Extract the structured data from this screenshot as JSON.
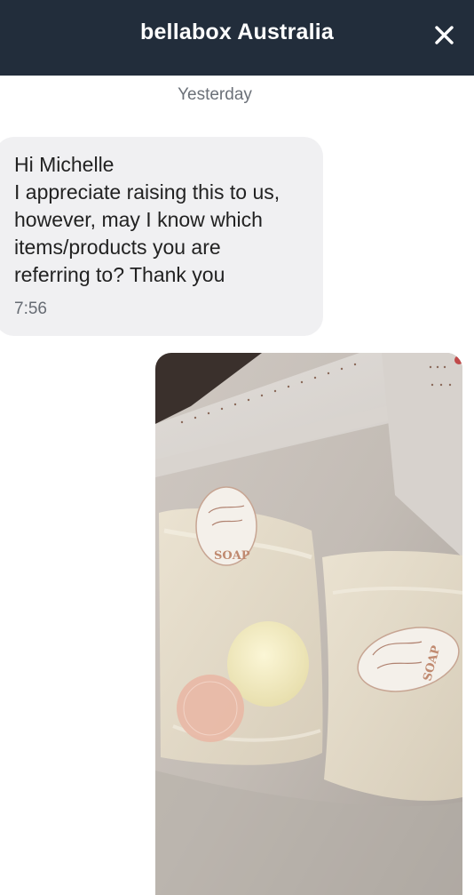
{
  "header": {
    "title": "bellabox Australia",
    "close_icon": "close-icon"
  },
  "conversation": {
    "date_separator": "Yesterday",
    "messages": [
      {
        "direction": "incoming",
        "lines": [
          "Hi Michelle",
          "I appreciate raising this to us,",
          "however, may I know which",
          "items/products you are",
          "referring to? Thank you"
        ],
        "time": "7:56"
      },
      {
        "direction": "outgoing",
        "type": "photo",
        "photo_description_icon": "photo-attachment"
      }
    ]
  },
  "colors": {
    "header_bg": "#222d3b",
    "incoming_bubble_bg": "#f0f0f2",
    "timestamp": "#666b73"
  }
}
